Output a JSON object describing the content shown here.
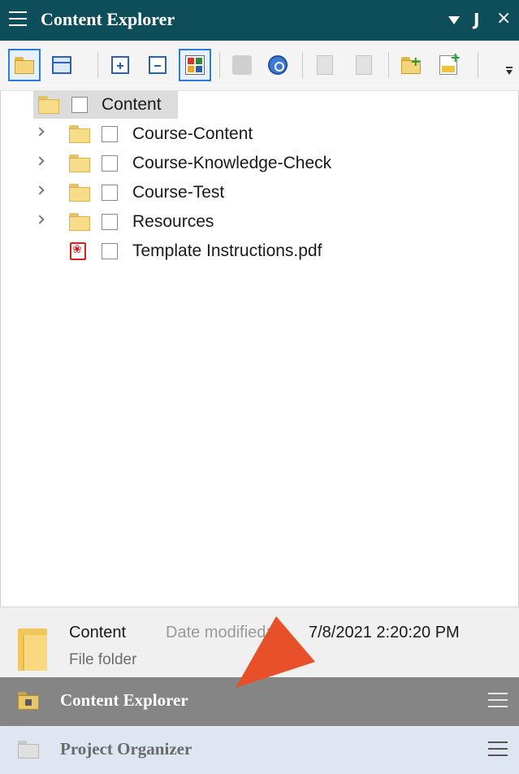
{
  "window": {
    "title": "Content Explorer",
    "controls": {
      "menu_icon": "hamburger-icon",
      "dropdown_icon": "caret-down-icon",
      "pin_glyph": "\u0004",
      "close_glyph": "×"
    }
  },
  "toolbar": {
    "buttons": [
      {
        "name": "folder-view-icon",
        "selected": true
      },
      {
        "name": "grid-view-icon",
        "has_dropdown": true
      },
      {
        "name": "expand-all-icon"
      },
      {
        "name": "collapse-all-icon"
      },
      {
        "name": "color-tiles-icon",
        "selected": true
      },
      {
        "name": "bind-icon",
        "disabled": true
      },
      {
        "name": "sync-icon"
      },
      {
        "name": "document-icon",
        "disabled": true
      },
      {
        "name": "preview-icon",
        "disabled": true
      },
      {
        "name": "new-folder-icon"
      },
      {
        "name": "new-document-icon"
      }
    ]
  },
  "tree": {
    "root": {
      "label": "Content"
    },
    "items": [
      {
        "label": "Course-Content",
        "type": "folder"
      },
      {
        "label": "Course-Knowledge-Check",
        "type": "folder"
      },
      {
        "label": "Course-Test",
        "type": "folder"
      },
      {
        "label": "Resources",
        "type": "folder"
      },
      {
        "label": "Template Instructions.pdf",
        "type": "pdf"
      }
    ]
  },
  "details": {
    "name": "Content",
    "date_label": "Date modified:",
    "date_value": "7/8/2021 2:20:20 PM",
    "type": "File folder"
  },
  "panes": [
    {
      "label": "Content Explorer",
      "active": true
    },
    {
      "label": "Project Organizer",
      "active": false
    }
  ],
  "colors": {
    "titlebar": "#0e4d5a",
    "selection_border": "#2c7fd6",
    "active_pane": "#858585",
    "inactive_pane": "#dde6f1",
    "callout_arrow": "#e8502a"
  }
}
